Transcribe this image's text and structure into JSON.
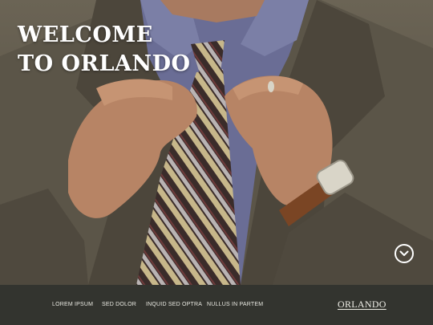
{
  "hero": {
    "headline_line1": "WELCOME",
    "headline_line2": "TO ORLANDO",
    "scroll_icon": "chevron-down-circle-icon"
  },
  "navbar": {
    "items": [
      {
        "label": "LOREM IPSUM"
      },
      {
        "label": "SED DOLOR"
      },
      {
        "label": "INQUID SED OPTRA"
      },
      {
        "label": "NULLUS IN PARTEM"
      }
    ],
    "brand": "ORLANDO"
  },
  "colors": {
    "navbar_bg": "#33342f",
    "headline_text": "#ffffff",
    "nav_text": "#e9e9e2"
  }
}
